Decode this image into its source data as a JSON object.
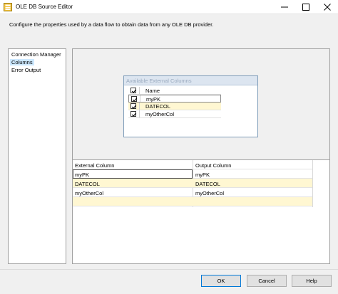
{
  "window": {
    "title": "OLE DB Source Editor",
    "icon": "ssis-component-icon"
  },
  "description": "Configure the properties used by a data flow to obtain data from any OLE DB provider.",
  "nav": {
    "items": [
      {
        "label": "Connection Manager",
        "selected": false
      },
      {
        "label": "Columns",
        "selected": true
      },
      {
        "label": "Error Output",
        "selected": false
      }
    ]
  },
  "available_columns": {
    "title": "Available External Columns",
    "rows": [
      {
        "label": "Name",
        "checked": true
      },
      {
        "label": "myPK",
        "checked": true
      },
      {
        "label": "DATECOL",
        "checked": true
      },
      {
        "label": "myOtherCol",
        "checked": true
      }
    ]
  },
  "mapping": {
    "headers": {
      "external": "External Column",
      "output": "Output Column"
    },
    "rows": [
      {
        "external": "myPK",
        "output": "myPK"
      },
      {
        "external": "DATECOL",
        "output": "DATECOL"
      },
      {
        "external": "myOtherCol",
        "output": "myOtherCol"
      },
      {
        "external": "",
        "output": ""
      }
    ]
  },
  "buttons": {
    "ok": "OK",
    "cancel": "Cancel",
    "help": "Help"
  },
  "colors": {
    "selection": "#cce8ff",
    "highlight_row": "#fff7d2",
    "accent": "#0078d7"
  }
}
